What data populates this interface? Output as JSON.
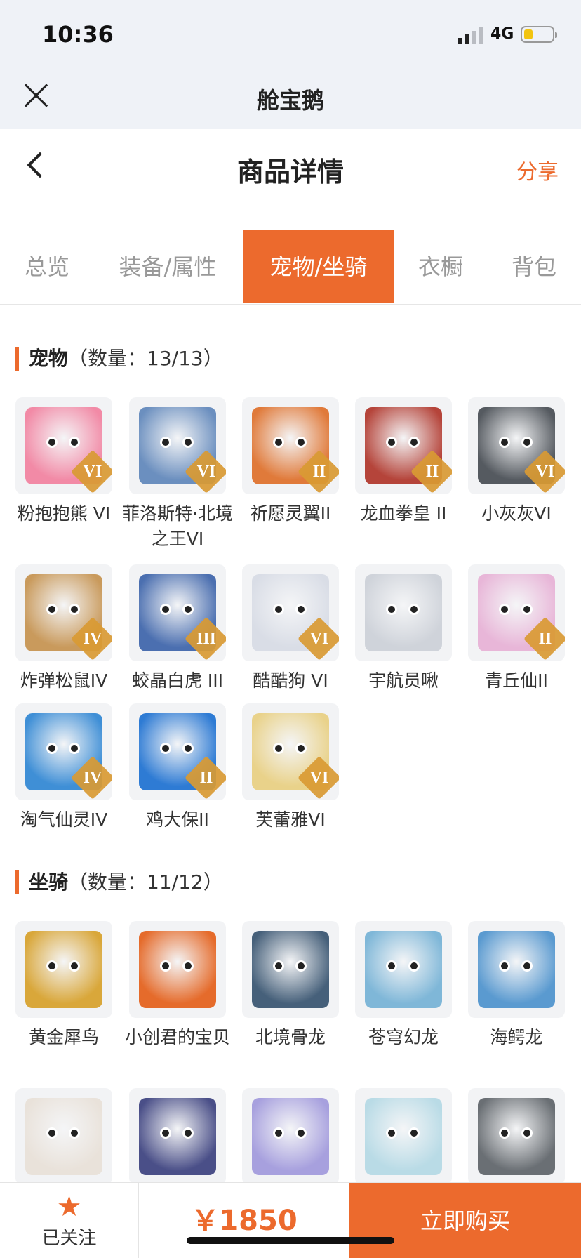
{
  "status": {
    "time": "10:36",
    "network": "4G"
  },
  "app": {
    "title": "舱宝鹅"
  },
  "nav": {
    "title": "商品详情",
    "share": "分享"
  },
  "tabs": [
    {
      "label": "总览",
      "active": false
    },
    {
      "label": "装备/属性",
      "active": false
    },
    {
      "label": "宠物/坐骑",
      "active": true
    },
    {
      "label": "衣橱",
      "active": false
    },
    {
      "label": "背包",
      "active": false
    }
  ],
  "pets": {
    "title": "宠物",
    "count": "（数量：13/13）",
    "items": [
      {
        "name": "粉抱抱熊 VI",
        "rank": "VI",
        "color": "#f28aa6"
      },
      {
        "name": "菲洛斯特·北境之王VI",
        "rank": "VI",
        "color": "#6b8fbf"
      },
      {
        "name": "祈愿灵翼II",
        "rank": "II",
        "color": "#e07a3a"
      },
      {
        "name": "龙血拳皇 II",
        "rank": "II",
        "color": "#b5443a"
      },
      {
        "name": "小灰灰VI",
        "rank": "VI",
        "color": "#555a60"
      },
      {
        "name": "炸弹松鼠IV",
        "rank": "IV",
        "color": "#c99a5c"
      },
      {
        "name": "蛟晶白虎 III",
        "rank": "III",
        "color": "#4b6fb0"
      },
      {
        "name": "酷酷狗 VI",
        "rank": "VI",
        "color": "#d9dde6"
      },
      {
        "name": "宇航员啾",
        "rank": "",
        "color": "#cfd3da"
      },
      {
        "name": "青丘仙II",
        "rank": "II",
        "color": "#e8b6d8"
      },
      {
        "name": "淘气仙灵IV",
        "rank": "IV",
        "color": "#3f8fd6"
      },
      {
        "name": "鸡大保II",
        "rank": "II",
        "color": "#2e7bd4"
      },
      {
        "name": "芙蕾雅VI",
        "rank": "VI",
        "color": "#e9d28a"
      }
    ]
  },
  "mounts": {
    "title": "坐骑",
    "count": "（数量：11/12）",
    "items": [
      {
        "name": "黄金犀鸟",
        "rank": "",
        "color": "#d9a73a"
      },
      {
        "name": "小创君的宝贝",
        "rank": "",
        "color": "#e56b2b"
      },
      {
        "name": "北境骨龙",
        "rank": "",
        "color": "#46607a"
      },
      {
        "name": "苍穹幻龙",
        "rank": "",
        "color": "#7fb7d8"
      },
      {
        "name": "海鳄龙",
        "rank": "",
        "color": "#5a9ad0"
      },
      {
        "name": "",
        "rank": "",
        "color": "#e9e2da"
      },
      {
        "name": "",
        "rank": "",
        "color": "#4a4f88"
      },
      {
        "name": "",
        "rank": "",
        "color": "#a7a0de"
      },
      {
        "name": "",
        "rank": "",
        "color": "#b9dbe6"
      },
      {
        "name": "",
        "rank": "",
        "color": "#6a6f74"
      }
    ]
  },
  "bottom": {
    "follow": "已关注",
    "price": "￥1850",
    "buy": "立即购买"
  }
}
